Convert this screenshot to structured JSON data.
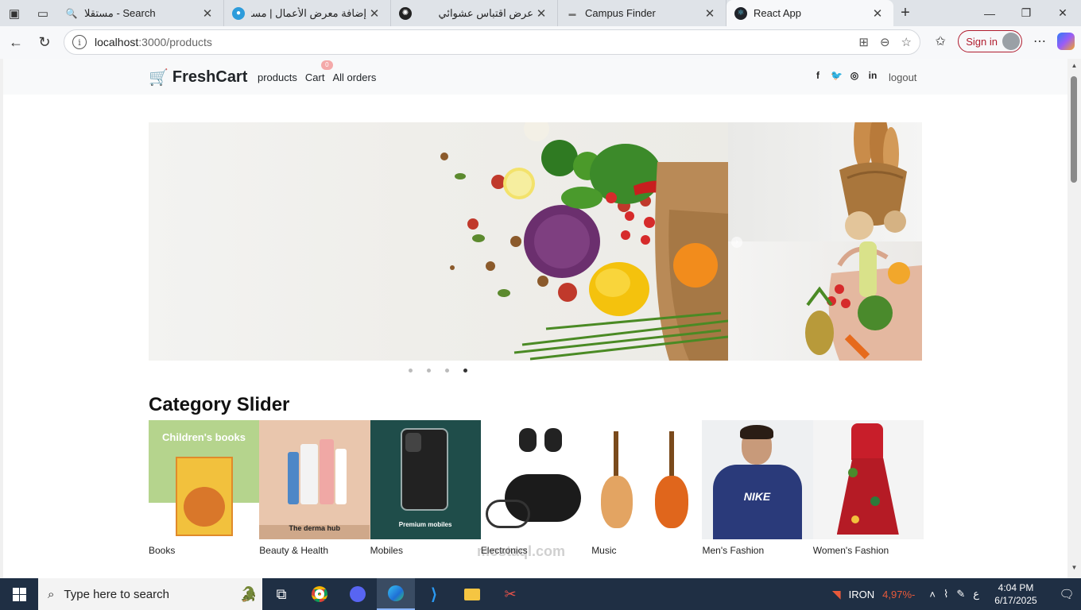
{
  "browser": {
    "tabs": [
      {
        "title": "مستقلا - Search",
        "favicon": "search-icon",
        "active": false
      },
      {
        "title": "إضافة معرض الأعمال | مستقل",
        "favicon": "mostaql-icon",
        "active": false
      },
      {
        "title": "عرض اقتباس عشوائي",
        "favicon": "openai-icon",
        "active": false
      },
      {
        "title": "Campus Finder",
        "favicon": "campus-icon",
        "active": false
      },
      {
        "title": "React App",
        "favicon": "react-icon",
        "active": true
      }
    ],
    "url_host": "localhost",
    "url_path": ":3000/products",
    "signin_label": "Sign in"
  },
  "site": {
    "brand": "FreshCart",
    "nav": {
      "products": "products",
      "cart": "Cart",
      "orders": "All orders"
    },
    "cart_count": "0",
    "logout": "logout",
    "socials": [
      "facebook-icon",
      "twitter-icon",
      "whatsapp-icon",
      "linkedin-icon"
    ]
  },
  "hero": {
    "slides_count": 4,
    "active_slide": 4
  },
  "category": {
    "title": "Category Slider",
    "items": [
      {
        "name": "Books",
        "banner": "Children's books"
      },
      {
        "name": "Beauty & Health",
        "banner": "The derma hub"
      },
      {
        "name": "Mobiles",
        "banner": "Premium mobiles"
      },
      {
        "name": "Electronics",
        "banner": ""
      },
      {
        "name": "Music",
        "banner": ""
      },
      {
        "name": "Men's Fashion",
        "banner": ""
      },
      {
        "name": "Women's Fashion",
        "banner": ""
      }
    ]
  },
  "watermark": "mostaql.com",
  "taskbar": {
    "search_placeholder": "Type here to search",
    "stock_name": "IRON",
    "stock_change": "-4,97%",
    "lang": "ع",
    "time": "4:04 PM",
    "date": "6/17/2025"
  },
  "colors": {
    "brand_green": "#0aad0a",
    "accent_red": "#b01c2e",
    "taskbar": "#1f2f44"
  }
}
